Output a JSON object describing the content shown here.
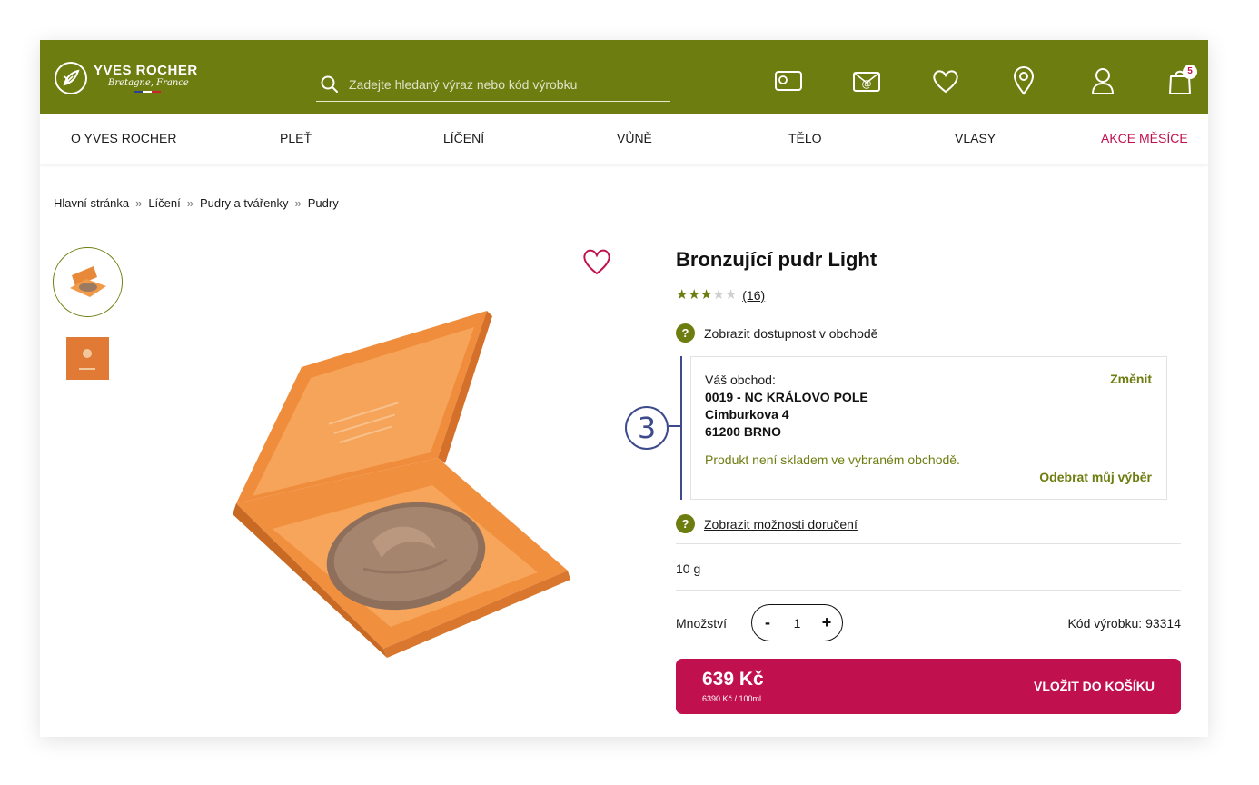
{
  "header": {
    "brand_name": "YVES ROCHER",
    "brand_tagline": "Bretagne, France",
    "search_placeholder": "Zadejte hledaný výraz nebo kód výrobku",
    "cart_count": "5",
    "icons": [
      "gift-card-icon",
      "newsletter-icon",
      "heart-icon",
      "location-pin-icon",
      "user-icon",
      "shopping-bag-icon"
    ]
  },
  "nav": {
    "items": [
      "O YVES ROCHER",
      "PLEŤ",
      "LÍČENÍ",
      "VŮNĚ",
      "TĚLO",
      "VLASY",
      "AKCE MĚSÍCE"
    ]
  },
  "breadcrumb": [
    "Hlavní stránka",
    "Líčení",
    "Pudry a tvářenky",
    "Pudry"
  ],
  "breadcrumb_separator": "»",
  "product": {
    "title": "Bronzující pudr Light",
    "rating": 3,
    "rating_max": 5,
    "reviews": "(16)",
    "availability_link": "Zobrazit dostupnost v obchodě",
    "store": {
      "label": "Váš obchod:",
      "name": "0019 - NC KRÁLOVO POLE",
      "street": "Cimburkova 4",
      "city": "61200 BRNO",
      "change": "Změnit",
      "stock_message": "Produkt není skladem ve vybraném obchodě.",
      "remove": "Odebrat můj výběr"
    },
    "delivery_link": "Zobrazit možnosti doručení",
    "size": "10 g",
    "quantity_label": "Množství",
    "quantity": "1",
    "sku": "Kód výrobku: 93314",
    "price": "639 Kč",
    "unit_price": "6390 Kč / 100ml",
    "cart_button": "VLOŽIT DO KOŠÍKU"
  },
  "annotation": {
    "step": "3"
  },
  "colors": {
    "brand_green": "#6e7d10",
    "accent_pink": "#c0104e",
    "annotation_blue": "#3d4a8c"
  }
}
